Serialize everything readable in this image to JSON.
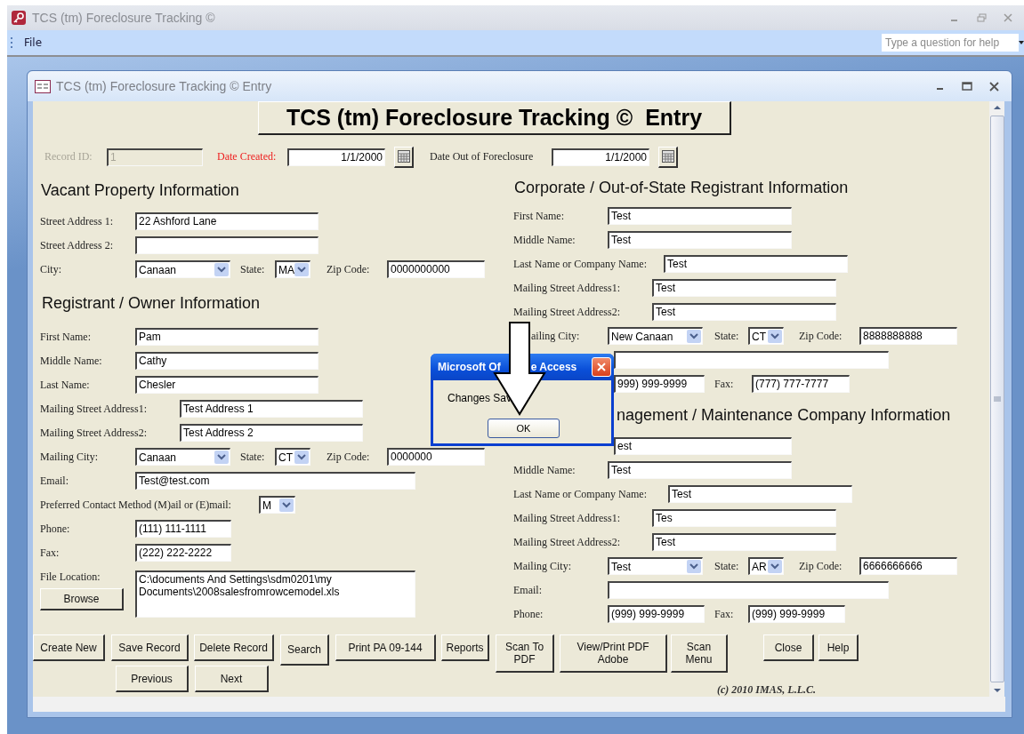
{
  "app": {
    "title": "TCS (tm) Foreclosure Tracking ©",
    "menu": [
      {
        "label": "File"
      }
    ],
    "help_search": {
      "placeholder": "Type a question for help"
    }
  },
  "form_window": {
    "title": "TCS (tm) Foreclosure Tracking ©  Entry"
  },
  "form_header": "TCS (tm) Foreclosure Tracking ©  Entry",
  "date_row": [
    {
      "kind": "label",
      "text": "Record ID:",
      "disabled": true,
      "required": false
    },
    {
      "kind": "text",
      "value": "1",
      "disabled": true
    },
    {
      "kind": "label",
      "text": "Date Created:",
      "disabled": false,
      "required": true
    },
    {
      "kind": "date",
      "value": "1/1/2000",
      "disabled": false
    },
    {
      "kind": "calendar",
      "disabled": false
    },
    {
      "kind": "label",
      "text": "Date Out of Foreclosure",
      "disabled": false,
      "required": false
    },
    {
      "kind": "date",
      "value": "1/1/2000",
      "disabled": false
    },
    {
      "kind": "calendar",
      "disabled": false
    }
  ],
  "left_sections": [
    {
      "heading": "Vacant Property Information",
      "rows": [
        [
          {
            "kind": "label",
            "text": "Street Address 1:"
          },
          {
            "kind": "text",
            "value": "22 Ashford Lane"
          }
        ],
        [
          {
            "kind": "label",
            "text": "Street Address 2:"
          },
          {
            "kind": "text"
          }
        ],
        [
          {
            "kind": "label",
            "text": "City:"
          },
          {
            "kind": "combo",
            "value": "Canaan"
          },
          {
            "kind": "label",
            "text": "State:"
          },
          {
            "kind": "combo",
            "value": "MA"
          },
          {
            "kind": "label",
            "text": "Zip Code:"
          },
          {
            "kind": "text",
            "value": "0000000000"
          }
        ]
      ]
    },
    {
      "heading": "Registrant / Owner Information",
      "rows": [
        [
          {
            "kind": "label",
            "text": "First Name:"
          },
          {
            "kind": "text",
            "value": "Pam"
          }
        ],
        [
          {
            "kind": "label",
            "text": "Middle Name:"
          },
          {
            "kind": "text",
            "value": "Cathy"
          }
        ],
        [
          {
            "kind": "label",
            "text": "Last Name:"
          },
          {
            "kind": "text",
            "value": "Chesler"
          }
        ],
        [
          {
            "kind": "label",
            "text": "Mailing Street Address1:"
          },
          {
            "kind": "text",
            "value": "Test Address 1"
          }
        ],
        [
          {
            "kind": "label",
            "text": "Mailing Street Address2:"
          },
          {
            "kind": "text",
            "value": "Test Address 2"
          }
        ],
        [
          {
            "kind": "label",
            "text": "Mailing City:"
          },
          {
            "kind": "combo",
            "value": "Canaan"
          },
          {
            "kind": "label",
            "text": "State:"
          },
          {
            "kind": "combo",
            "value": "CT"
          },
          {
            "kind": "label",
            "text": "Zip Code:"
          },
          {
            "kind": "text",
            "value": "0000000"
          }
        ],
        [
          {
            "kind": "label",
            "text": "Email:"
          },
          {
            "kind": "text",
            "value": "Test@test.com"
          }
        ],
        [
          {
            "kind": "label",
            "text": "Preferred Contact Method (M)ail or (E)mail:"
          },
          {
            "kind": "combo",
            "value": "M"
          }
        ],
        [
          {
            "kind": "label",
            "text": "Phone:"
          },
          {
            "kind": "text",
            "value": "(111) 111-1111"
          }
        ],
        [
          {
            "kind": "label",
            "text": "Fax:"
          },
          {
            "kind": "text",
            "value": "(222) 222-2222"
          }
        ]
      ]
    }
  ],
  "file_location": {
    "label": "File Location:",
    "browse": "Browse",
    "value": "C:\\documents And Settings\\sdm0201\\my Documents\\2008salesfromrowcemodel.xls"
  },
  "right_sections": [
    {
      "heading": "Corporate / Out-of-State Registrant Information",
      "rows": [
        [
          {
            "kind": "label",
            "text": "First Name:"
          },
          {
            "kind": "text",
            "value": "Test"
          }
        ],
        [
          {
            "kind": "label",
            "text": "Middle Name:"
          },
          {
            "kind": "text",
            "value": "Test"
          }
        ],
        [
          {
            "kind": "label",
            "text": "Last Name or Company Name:"
          },
          {
            "kind": "text",
            "value": "Test"
          }
        ],
        [
          {
            "kind": "label",
            "text": "Mailing Street Address1:"
          },
          {
            "kind": "text",
            "value": "Test"
          }
        ],
        [
          {
            "kind": "label",
            "text": "Mailing Street Address2:"
          },
          {
            "kind": "text",
            "value": "Test"
          }
        ],
        [
          {
            "kind": "label",
            "text": "ailing City:"
          },
          {
            "kind": "combo",
            "value": "New Canaan"
          },
          {
            "kind": "label",
            "text": "State:"
          },
          {
            "kind": "combo",
            "value": "CT"
          },
          {
            "kind": "label",
            "text": "Zip Code:"
          },
          {
            "kind": "text",
            "value": "8888888888"
          }
        ],
        [
          {
            "kind": "covered"
          },
          {
            "kind": "text"
          }
        ],
        [
          {
            "kind": "covered"
          },
          {
            "kind": "text",
            "value": "999) 999-9999"
          },
          {
            "kind": "label",
            "text": "Fax:"
          },
          {
            "kind": "text",
            "value": "(777) 777-7777"
          }
        ]
      ]
    },
    {
      "heading": "nagement / Maintenance Company Information",
      "rows": [
        [
          {
            "kind": "covered"
          },
          {
            "kind": "text",
            "value": "est"
          }
        ],
        [
          {
            "kind": "label",
            "text": "Middle Name:"
          },
          {
            "kind": "text",
            "value": "Test"
          }
        ],
        [
          {
            "kind": "label",
            "text": "Last Name or Company Name:"
          },
          {
            "kind": "text",
            "value": "Test"
          }
        ],
        [
          {
            "kind": "label",
            "text": "Mailing Street Address1:"
          },
          {
            "kind": "text",
            "value": "Tes"
          }
        ],
        [
          {
            "kind": "label",
            "text": "Mailing Street Address2:"
          },
          {
            "kind": "text",
            "value": "Test"
          }
        ],
        [
          {
            "kind": "label",
            "text": "Mailing City:"
          },
          {
            "kind": "combo",
            "value": "Test"
          },
          {
            "kind": "label",
            "text": "State:"
          },
          {
            "kind": "combo",
            "value": "AR"
          },
          {
            "kind": "label",
            "text": "Zip Code:"
          },
          {
            "kind": "text",
            "value": "6666666666"
          }
        ],
        [
          {
            "kind": "label",
            "text": "Email:"
          },
          {
            "kind": "text"
          }
        ],
        [
          {
            "kind": "label",
            "text": "Phone:"
          },
          {
            "kind": "text",
            "value": "(999) 999-9999"
          },
          {
            "kind": "label",
            "text": "Fax:"
          },
          {
            "kind": "text",
            "value": "(999) 999-9999"
          }
        ]
      ]
    }
  ],
  "button_rows": [
    [
      {
        "label": "Create New"
      },
      {
        "label": "Save Record"
      },
      {
        "label": "Delete Record"
      },
      {
        "label": "Search"
      },
      {
        "label": "Print PA 09-144"
      },
      {
        "label": "Reports"
      },
      {
        "label": "Scan To PDF"
      },
      {
        "label": "View/Print PDF Adobe"
      },
      {
        "label": "Scan Menu"
      },
      {
        "label": "Close"
      },
      {
        "label": "Help"
      }
    ],
    [
      {
        "label": "Previous"
      },
      {
        "label": "Next"
      }
    ]
  ],
  "copyright": "(c) 2010 IMAS, L.L.C.",
  "dialog": {
    "title_parts": [
      "Microsoft Of",
      "e Access"
    ],
    "message": "Changes Sav",
    "button": "OK"
  }
}
